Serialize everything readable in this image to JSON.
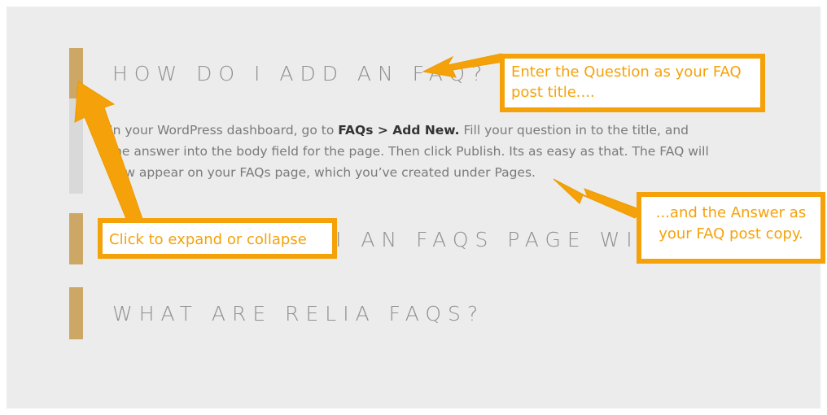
{
  "faqs": [
    {
      "title": "How do I add an FAQ?"
    },
    {
      "title_visible": "I AN FAQS PAGE WITH F"
    },
    {
      "title": "What are Relia FAQs?"
    }
  ],
  "answer": {
    "line1_pre": "In your WordPress dashboard, go to ",
    "line1_bold": "FAQs > Add New.",
    "line1_post": " Fill your question in to the title, and",
    "line2": "the answer into the body field for the page. Then click Publish. Its as easy as that. The FAQ will",
    "line3": "now appear on your FAQs page, which you’ve created under Pages."
  },
  "callouts": {
    "question": "Enter the Question as your FAQ post title....",
    "answer": "...and the Answer as your FAQ post copy.",
    "toggle": "Click to expand or collapse"
  },
  "colors": {
    "accent_bar": "#cda766",
    "callout_orange": "#f5a20a",
    "background": "#ececec",
    "title_text": "#8f8f8f"
  }
}
